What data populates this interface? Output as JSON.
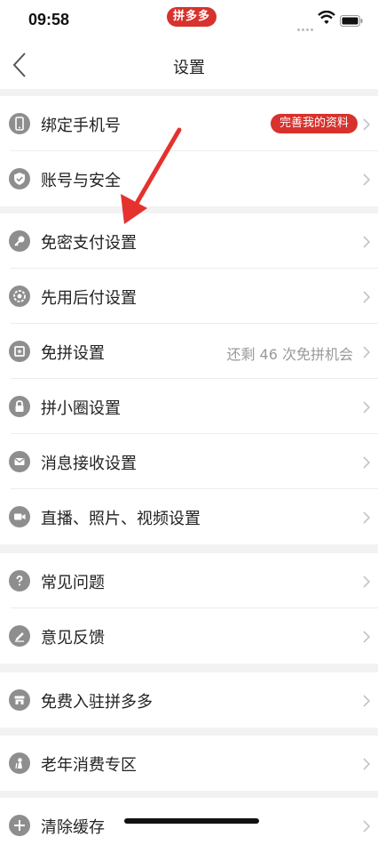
{
  "status": {
    "time": "09:58",
    "app_badge": "拼多多"
  },
  "nav": {
    "title": "设置"
  },
  "groups": [
    {
      "items": [
        {
          "label": "绑定手机号",
          "badge": "完善我的资料",
          "icon": "phone-icon"
        },
        {
          "label": "账号与安全",
          "icon": "shield-icon"
        }
      ]
    },
    {
      "items": [
        {
          "label": "免密支付设置",
          "icon": "key-icon"
        },
        {
          "label": "先用后付设置",
          "icon": "badge-icon"
        },
        {
          "label": "免拼设置",
          "value": "还剩 46 次免拼机会",
          "icon": "ticket-icon"
        },
        {
          "label": "拼小圈设置",
          "icon": "lock-icon"
        },
        {
          "label": "消息接收设置",
          "icon": "mail-icon"
        },
        {
          "label": "直播、照片、视频设置",
          "icon": "video-icon"
        }
      ]
    },
    {
      "items": [
        {
          "label": "常见问题",
          "icon": "question-icon"
        },
        {
          "label": "意见反馈",
          "icon": "pencil-icon"
        }
      ]
    },
    {
      "items": [
        {
          "label": "免费入驻拼多多",
          "icon": "store-icon"
        }
      ]
    },
    {
      "items": [
        {
          "label": "老年消费专区",
          "icon": "elder-icon"
        }
      ]
    },
    {
      "items": [
        {
          "label": "清除缓存",
          "icon": "clear-cache-icon"
        }
      ]
    }
  ],
  "colors": {
    "accent": "#d7322d",
    "icon_gray": "#8e8e8e",
    "background": "#f2f2f2"
  }
}
